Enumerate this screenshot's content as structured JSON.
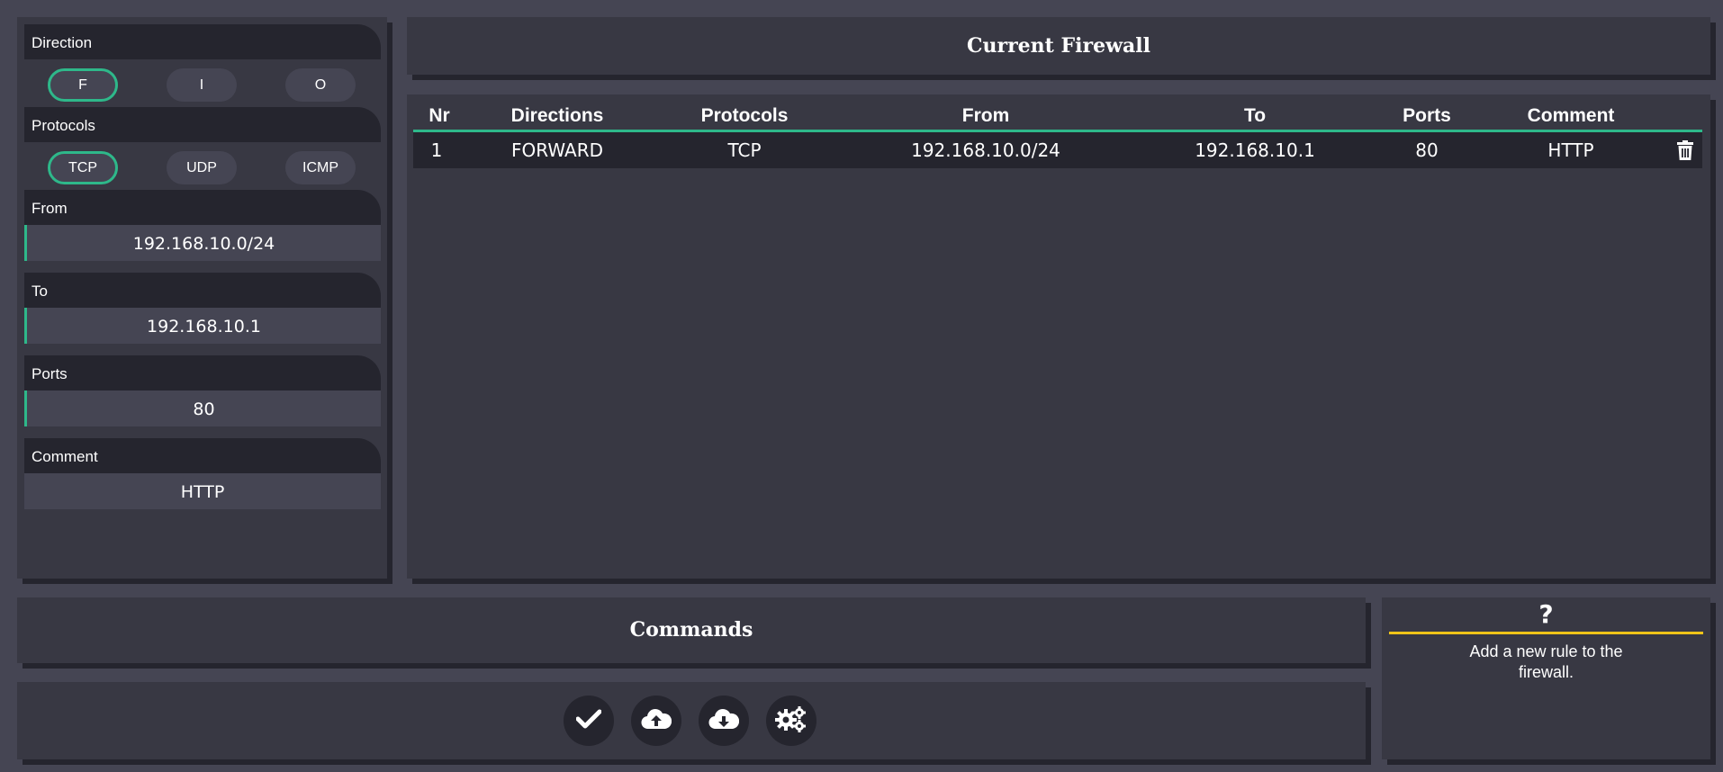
{
  "form": {
    "direction": {
      "label": "Direction",
      "options": [
        "F",
        "I",
        "O"
      ],
      "selected": "F"
    },
    "protocols": {
      "label": "Protocols",
      "options": [
        "TCP",
        "UDP",
        "ICMP"
      ],
      "selected": "TCP"
    },
    "from": {
      "label": "From",
      "value": "192.168.10.0/24"
    },
    "to": {
      "label": "To",
      "value": "192.168.10.1"
    },
    "ports": {
      "label": "Ports",
      "value": "80"
    },
    "comment": {
      "label": "Comment",
      "value": "HTTP"
    }
  },
  "firewall": {
    "title": "Current Firewall",
    "columns": [
      "Nr",
      "Directions",
      "Protocols",
      "From",
      "To",
      "Ports",
      "Comment"
    ],
    "rows": [
      {
        "nr": "1",
        "direction": "FORWARD",
        "protocol": "TCP",
        "from": "192.168.10.0/24",
        "to": "192.168.10.1",
        "ports": "80",
        "comment": "HTTP"
      }
    ]
  },
  "commands": {
    "title": "Commands",
    "buttons": [
      "check-icon",
      "cloud-upload-icon",
      "cloud-download-icon",
      "gears-icon"
    ]
  },
  "help": {
    "symbol": "?",
    "text": "Add a new rule to the firewall."
  },
  "colors": {
    "accent": "#2eb88a",
    "help_line": "#f0c419",
    "background": "#454553",
    "panel": "#383843",
    "dark": "#25252e"
  }
}
